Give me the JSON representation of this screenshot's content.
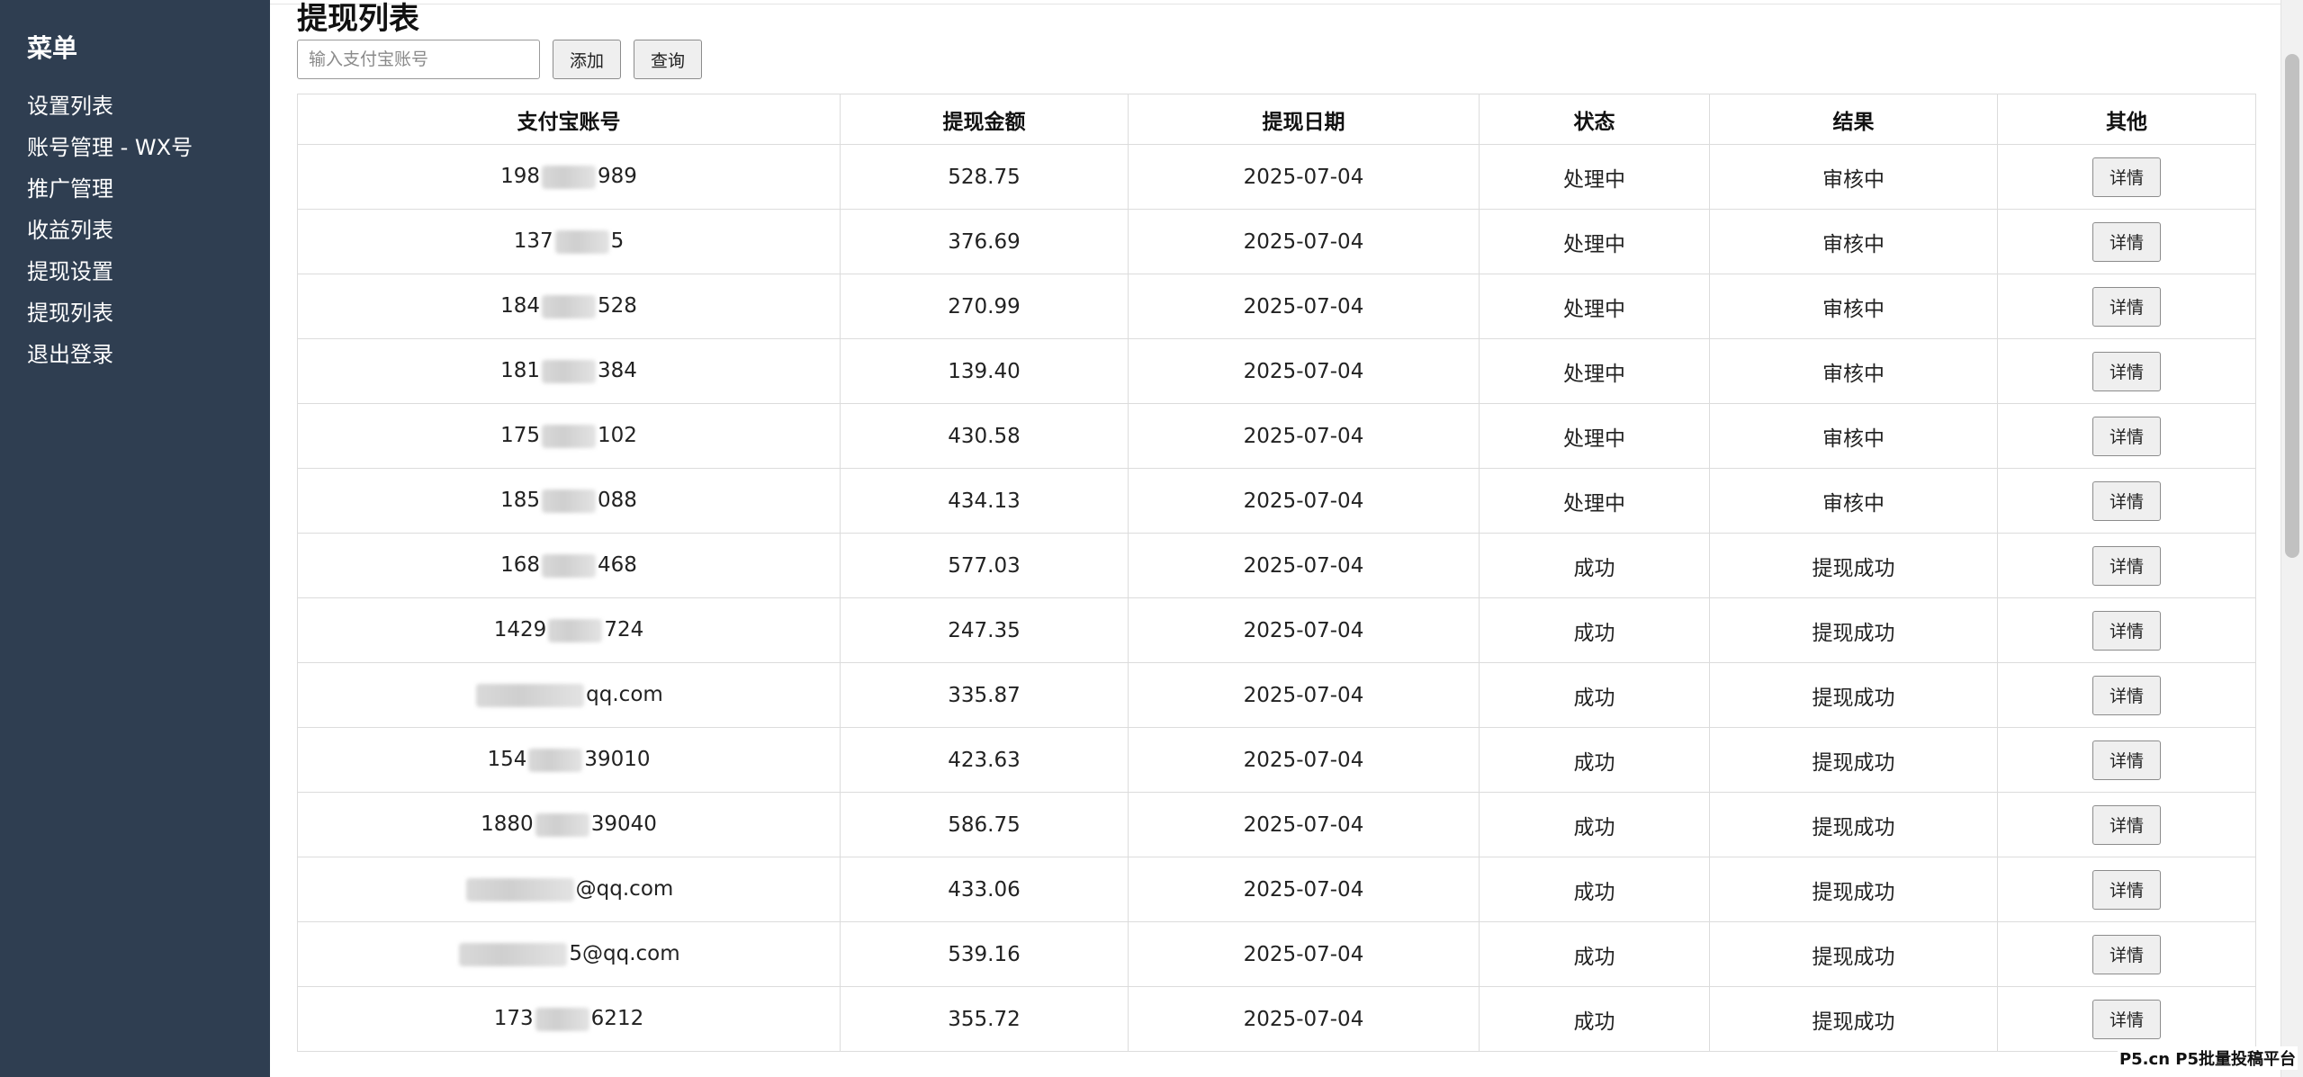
{
  "sidebar": {
    "title": "菜单",
    "items": [
      {
        "label": "设置列表"
      },
      {
        "label": "账号管理 - WX号"
      },
      {
        "label": "推广管理"
      },
      {
        "label": "收益列表"
      },
      {
        "label": "提现设置"
      },
      {
        "label": "提现列表"
      },
      {
        "label": "退出登录"
      }
    ]
  },
  "page": {
    "title": "提现列表"
  },
  "toolbar": {
    "search_placeholder": "输入支付宝账号",
    "add_label": "添加",
    "query_label": "查询"
  },
  "table": {
    "headers": [
      "支付宝账号",
      "提现金额",
      "提现日期",
      "状态",
      "结果",
      "其他"
    ],
    "detail_label": "详情",
    "rows": [
      {
        "account_prefix": "198",
        "account_suffix": "989",
        "amount": "528.75",
        "date": "2025-07-04",
        "status": "处理中",
        "result": "审核中"
      },
      {
        "account_prefix": "137",
        "account_suffix": "5",
        "amount": "376.69",
        "date": "2025-07-04",
        "status": "处理中",
        "result": "审核中"
      },
      {
        "account_prefix": "184",
        "account_suffix": "528",
        "amount": "270.99",
        "date": "2025-07-04",
        "status": "处理中",
        "result": "审核中"
      },
      {
        "account_prefix": "181",
        "account_suffix": "384",
        "amount": "139.40",
        "date": "2025-07-04",
        "status": "处理中",
        "result": "审核中"
      },
      {
        "account_prefix": "175",
        "account_suffix": "102",
        "amount": "430.58",
        "date": "2025-07-04",
        "status": "处理中",
        "result": "审核中"
      },
      {
        "account_prefix": "185",
        "account_suffix": "088",
        "amount": "434.13",
        "date": "2025-07-04",
        "status": "处理中",
        "result": "审核中"
      },
      {
        "account_prefix": "168",
        "account_suffix": "468",
        "amount": "577.03",
        "date": "2025-07-04",
        "status": "成功",
        "result": "提现成功"
      },
      {
        "account_prefix": "1429",
        "account_suffix": "724",
        "amount": "247.35",
        "date": "2025-07-04",
        "status": "成功",
        "result": "提现成功"
      },
      {
        "account_prefix": "",
        "account_suffix": "qq.com",
        "amount": "335.87",
        "date": "2025-07-04",
        "status": "成功",
        "result": "提现成功"
      },
      {
        "account_prefix": "154",
        "account_suffix": "39010",
        "amount": "423.63",
        "date": "2025-07-04",
        "status": "成功",
        "result": "提现成功"
      },
      {
        "account_prefix": "1880",
        "account_suffix": "39040",
        "amount": "586.75",
        "date": "2025-07-04",
        "status": "成功",
        "result": "提现成功"
      },
      {
        "account_prefix": "",
        "account_suffix": "@qq.com",
        "amount": "433.06",
        "date": "2025-07-04",
        "status": "成功",
        "result": "提现成功"
      },
      {
        "account_prefix": "",
        "account_suffix": "5@qq.com",
        "amount": "539.16",
        "date": "2025-07-04",
        "status": "成功",
        "result": "提现成功"
      },
      {
        "account_prefix": "173",
        "account_suffix": "6212",
        "amount": "355.72",
        "date": "2025-07-04",
        "status": "成功",
        "result": "提现成功"
      }
    ]
  },
  "watermark": "P5.cn P5批量投稿平台",
  "colors": {
    "sidebar_bg": "#2f3e51",
    "sidebar_text": "#ffffff",
    "button_bg": "#efefef",
    "table_border": "#dcdcdc"
  }
}
